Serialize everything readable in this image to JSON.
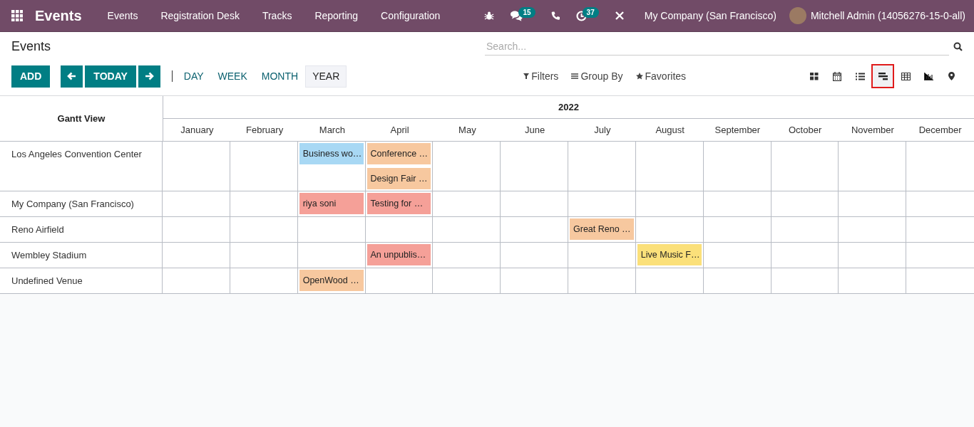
{
  "navbar": {
    "app_name": "Events",
    "menu": [
      "Events",
      "Registration Desk",
      "Tracks",
      "Reporting",
      "Configuration"
    ],
    "messages_badge": "15",
    "activities_badge": "37",
    "company": "My Company (San Francisco)",
    "user": "Mitchell Admin (14056276-15-0-all)"
  },
  "breadcrumb": "Events",
  "search": {
    "placeholder": "Search..."
  },
  "buttons": {
    "add": "ADD",
    "today": "TODAY"
  },
  "scales": [
    {
      "label": "DAY",
      "selected": false
    },
    {
      "label": "WEEK",
      "selected": false
    },
    {
      "label": "MONTH",
      "selected": false
    },
    {
      "label": "YEAR",
      "selected": true
    }
  ],
  "filters": [
    "Filters",
    "Group By",
    "Favorites"
  ],
  "views": [
    {
      "kind": "kanban",
      "selected": false
    },
    {
      "kind": "calendar",
      "selected": false
    },
    {
      "kind": "list",
      "selected": false
    },
    {
      "kind": "gantt",
      "selected": true
    },
    {
      "kind": "pivot",
      "selected": false
    },
    {
      "kind": "graph",
      "selected": false
    },
    {
      "kind": "map",
      "selected": false
    }
  ],
  "gantt": {
    "title": "Gantt View",
    "year": "2022",
    "months": [
      "January",
      "February",
      "March",
      "April",
      "May",
      "June",
      "July",
      "August",
      "September",
      "October",
      "November",
      "December"
    ],
    "rows": [
      {
        "name": "Los Angeles Convention Center",
        "cells": [
          [],
          [],
          [
            {
              "label": "Business wo…",
              "color": "#a8d8f4"
            }
          ],
          [
            {
              "label": "Conference …",
              "color": "#f7c89f"
            },
            {
              "label": "Design Fair …",
              "color": "#f7c89f"
            }
          ],
          [],
          [],
          [],
          [],
          [],
          [],
          [],
          []
        ]
      },
      {
        "name": "My Company (San Francisco)",
        "cells": [
          [],
          [],
          [
            {
              "label": "riya soni",
              "color": "#f5a098"
            }
          ],
          [
            {
              "label": "Testing for …",
              "color": "#f5a098"
            }
          ],
          [],
          [],
          [],
          [],
          [],
          [],
          [],
          []
        ]
      },
      {
        "name": "Reno Airfield",
        "cells": [
          [],
          [],
          [],
          [],
          [],
          [],
          [
            {
              "label": "Great Reno …",
              "color": "#f7c89f"
            }
          ],
          [],
          [],
          [],
          [],
          []
        ]
      },
      {
        "name": "Wembley Stadium",
        "cells": [
          [],
          [],
          [],
          [
            {
              "label": "An unpublis…",
              "color": "#f5a098"
            }
          ],
          [],
          [],
          [],
          [
            {
              "label": "Live Music F…",
              "color": "#fbe07a"
            }
          ],
          [],
          [],
          [],
          []
        ]
      },
      {
        "name": "Undefined Venue",
        "cells": [
          [],
          [],
          [
            {
              "label": "OpenWood …",
              "color": "#f7c89f"
            }
          ],
          [],
          [],
          [],
          [],
          [],
          [],
          [],
          [],
          []
        ]
      }
    ]
  }
}
